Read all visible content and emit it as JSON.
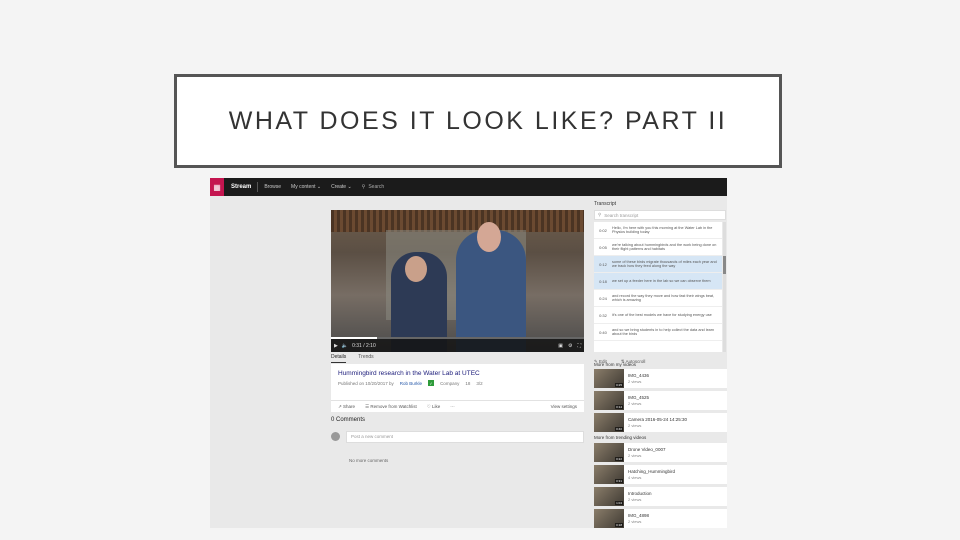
{
  "slide": {
    "title": "WHAT DOES IT LOOK LIKE? PART II"
  },
  "topbar": {
    "waffle_icon": "waffle-grid-icon",
    "brand": "Stream",
    "nav": [
      "Browse",
      "My content ⌄",
      "Create ⌄"
    ],
    "search_placeholder": "Search"
  },
  "player": {
    "time": "0:31 / 2:10",
    "progress": 0.18,
    "accent": "#c4154f"
  },
  "tabs": [
    "Details",
    "Trends"
  ],
  "video": {
    "title": "Hummingbird research in the Water Lab at UTEC",
    "uploaded": "Published on 10/20/2017 by",
    "author": "Rob Burkle",
    "category": "Company",
    "views": "18",
    "likes": "3/2"
  },
  "actions": [
    "Share",
    "Remove from Watchlist",
    "Like",
    "···"
  ],
  "actions_right": "View settings",
  "comments": {
    "heading": "0 Comments",
    "input_placeholder": "Post a new comment",
    "empty_text": "No more comments"
  },
  "transcript": {
    "title": "Transcript",
    "search_placeholder": "Search transcript",
    "rows": [
      {
        "time": "0:02",
        "text": "Hello, I'm here with you this morning at the Water Lab in the Physics building today",
        "highlight": false
      },
      {
        "time": "0:05",
        "text": "we're talking about hummingbirds and the work being done on their flight patterns and habitats",
        "highlight": false
      },
      {
        "time": "0:12",
        "text": "some of these birds migrate thousands of miles each year and we track how they feed along the way",
        "highlight": true
      },
      {
        "time": "0:18",
        "text": "we set up a feeder here in the lab so we can observe them",
        "highlight": true
      },
      {
        "time": "0:24",
        "text": "and record the way they move and how fast their wings beat, which is amazing",
        "highlight": false
      },
      {
        "time": "0:32",
        "text": "it's one of the best models we have for studying energy use",
        "highlight": false
      },
      {
        "time": "0:40",
        "text": "and so we bring students in to help collect the data and learn about the birds",
        "highlight": false
      }
    ],
    "footer": [
      "Edit",
      "Autoscroll"
    ]
  },
  "related_heading": "More from my videos",
  "related": [
    {
      "title": "IMG_4436",
      "views": "2 views",
      "duration": "0:25"
    },
    {
      "title": "IMG_4525",
      "views": "2 views",
      "duration": "0:14"
    },
    {
      "title": "Camera 2016-05-24 14:25:30",
      "views": "2 views",
      "duration": "0:40"
    }
  ],
  "trending_heading": "More from trending videos",
  "trending": [
    {
      "title": "Drone Video_0007",
      "views": "2 views",
      "duration": "0:22"
    },
    {
      "title": "Hatching_Hummingbird",
      "views": "4 views",
      "duration": "0:31"
    },
    {
      "title": "Introduction",
      "views": "2 views",
      "duration": "1:04"
    },
    {
      "title": "IMG_4898",
      "views": "2 views",
      "duration": "0:18"
    }
  ]
}
